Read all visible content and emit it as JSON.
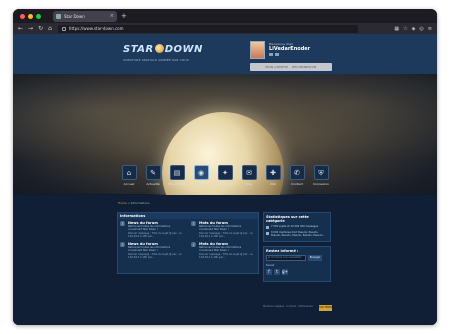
{
  "browser": {
    "tab_title": "Star Down",
    "url": "https://www.star-down.com",
    "dot_colors": [
      "#ff5f57",
      "#febc2e",
      "#28c840"
    ]
  },
  "site": {
    "logo_left": "STAR",
    "logo_right": "DOWN",
    "tagline": "AVENTURE SPATIALE ANIMÉE PAR VOUS",
    "user": {
      "welcome": "Bienvenue chez",
      "name": "LiVedarEnoder",
      "button": "MON COMPTE  ·  DÉCONNEXION"
    },
    "menu": [
      {
        "label": "Accueil",
        "icon": "home-icon",
        "glyph": "⌂"
      },
      {
        "label": "Actualité",
        "icon": "news-icon",
        "glyph": "✎"
      },
      {
        "label": "Présentation",
        "icon": "book-icon",
        "glyph": "▤"
      },
      {
        "label": "Forum",
        "icon": "forum-icon",
        "glyph": "◉"
      },
      {
        "label": "Fiche de jeu",
        "icon": "sheet-icon",
        "glyph": "✦"
      },
      {
        "label": "Blog",
        "icon": "blog-icon",
        "glyph": "✉"
      },
      {
        "label": "Wiki",
        "icon": "wiki-icon",
        "glyph": "✚"
      },
      {
        "label": "Contact",
        "icon": "contact-icon",
        "glyph": "✆"
      },
      {
        "label": "Connexion",
        "icon": "shield-icon",
        "glyph": "⛨"
      }
    ],
    "breadcrumb": {
      "home": "Home",
      "sep": "»",
      "current": "Informations"
    },
    "panel": {
      "title": "Informations",
      "forums": [
        {
          "name": "News du forum",
          "desc": "Retrouvez toutes les informations concernant Star Down !",
          "last": "Dernier message : Titre du sujet @ par... le 12/12/12 à 18h par..."
        },
        {
          "name": "Mots du forum",
          "desc": "Retrouvez toutes les informations concernant Star Down !",
          "last": "Dernier message : Titre du sujet @ par... le 12/12/12 à 18h par..."
        },
        {
          "name": "News du forum",
          "desc": "Retrouvez toutes les informations concernant Star Down !",
          "last": "Dernier message : Titre du sujet @ par... le 12/12/12 à 18h par..."
        },
        {
          "name": "Mots du forum",
          "desc": "Retrouvez toutes les informations concernant Star Down !",
          "last": "Dernier message : Titre du sujet @ par... le 12/12/12 à 18h par..."
        }
      ]
    },
    "stats": {
      "title": "Statistiques sur cette catégorie",
      "line1": "7 000 sujets et 10 000 000 messages",
      "line2": "0 000 membres dont Pseudo, Pseudo, Pseudo, Pseudo, Pseudo, Pseudo, Pseudo..."
    },
    "social": {
      "title": "Restez informé :",
      "placeholder": "Je m'inscris à la newsletter",
      "button": "Envoyer",
      "follow": "Suivez",
      "icons": [
        "f",
        "t",
        "g+"
      ]
    },
    "footer": "Mentions légales · Contact · Partenaires",
    "support": "SOUTENEZ"
  }
}
